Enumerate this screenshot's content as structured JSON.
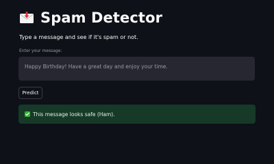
{
  "header": {
    "title": "Spam Detector",
    "icon": "envelope-with-arrow-icon"
  },
  "subtitle": "Type a message and see if it's spam or not.",
  "message_input": {
    "label": "Enter your message:",
    "value": "Happy Birthday! Have a great day and enjoy your time."
  },
  "predict_button": {
    "label": "Predict"
  },
  "result": {
    "icon": "check-mark-icon",
    "text": "This message looks safe (Ham).",
    "status_color": "#2eb82e"
  },
  "colors": {
    "background": "#0e1117",
    "input_background": "#262730",
    "success_background": "#173928"
  }
}
